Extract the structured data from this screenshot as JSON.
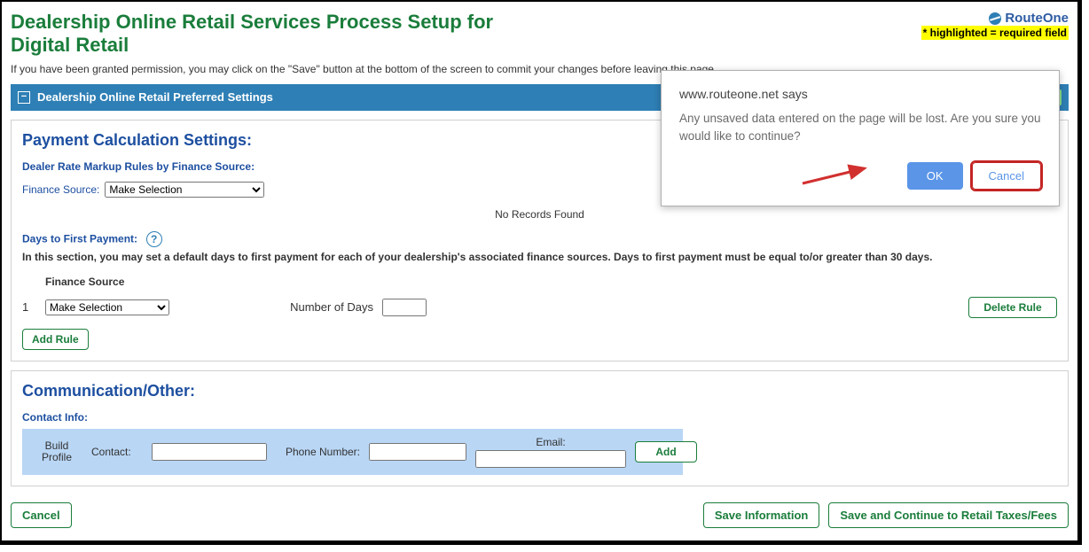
{
  "header": {
    "title": "Dealership Online Retail Services Process Setup for Digital Retail",
    "instruction": "If you have been granted permission, you may click on the \"Save\" button at the bottom of the screen to commit your changes before leaving this page.",
    "brand": "RouteOne",
    "required_hint": "* highlighted = required field"
  },
  "accordion": {
    "toggle": "−",
    "title": "Dealership Online Retail Preferred Settings"
  },
  "payment": {
    "section_title": "Payment Calculation Settings:",
    "rate_rules_label": "Dealer Rate Markup Rules by Finance Source:",
    "fs_label": "Finance Source:",
    "fs_selected": "Make Selection",
    "no_records": "No Records Found",
    "dtfp_label": "Days to First Payment:",
    "dtfp_desc": "In this section, you may set a default days to first payment for each of your dealership's associated finance sources. Days to first payment must be equal to/or greater than 30 days.",
    "col_fs": "Finance Source",
    "idx1": "1",
    "rule_select": "Make Selection",
    "numdays_label": "Number of Days",
    "delete_rule": "Delete Rule",
    "add_rule": "Add Rule"
  },
  "comm": {
    "section_title": "Communication/Other:",
    "contact_info": "Contact Info:",
    "build_profile": "Build Profile",
    "contact_label": "Contact:",
    "phone_label": "Phone Number:",
    "email_label": "Email:",
    "add_btn": "Add"
  },
  "footer": {
    "cancel": "Cancel",
    "save_info": "Save Information",
    "save_continue": "Save and Continue to Retail Taxes/Fees"
  },
  "dialog": {
    "origin": "www.routeone.net says",
    "message": "Any unsaved data entered on the page will be lost. Are you sure you would like to continue?",
    "ok": "OK",
    "cancel": "Cancel"
  }
}
